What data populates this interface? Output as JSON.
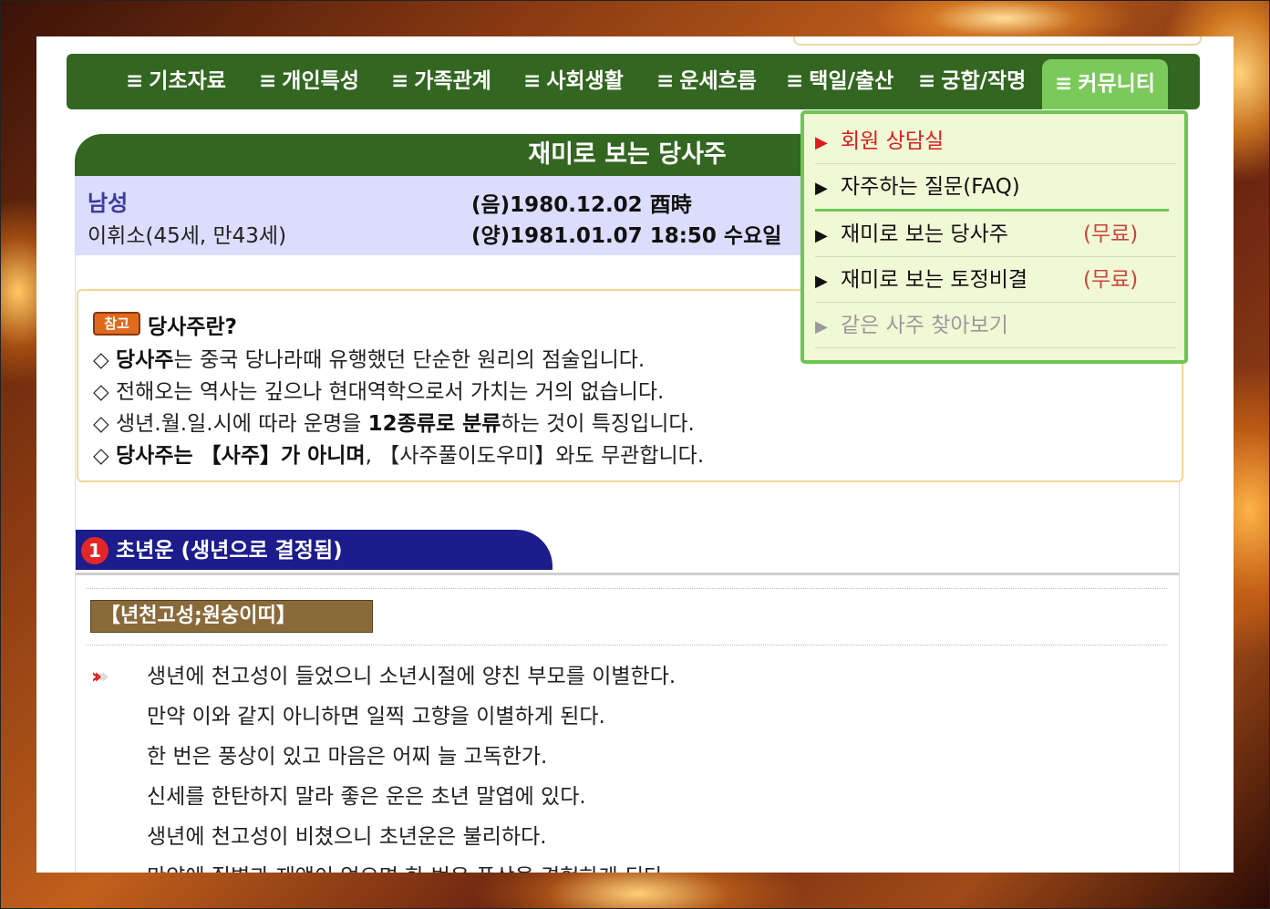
{
  "nav": {
    "glyph": "≡",
    "items": [
      {
        "label": "기초자료"
      },
      {
        "label": "개인특성"
      },
      {
        "label": "가족관계"
      },
      {
        "label": "사회생활"
      },
      {
        "label": "운세흐름"
      },
      {
        "label": "택일/출산"
      },
      {
        "label": "궁합/작명"
      },
      {
        "label": "커뮤니티"
      }
    ]
  },
  "dropdown": {
    "items": [
      {
        "label": "회원 상담실",
        "free": ""
      },
      {
        "label": "자주하는 질문(FAQ)",
        "free": ""
      },
      {
        "label": "재미로 보는 당사주",
        "free": "(무료)"
      },
      {
        "label": "재미로 보는 토정비결",
        "free": "(무료)"
      },
      {
        "label": "같은 사주 찾아보기",
        "free": ""
      }
    ],
    "marker": "▶"
  },
  "page": {
    "title": "재미로 보는 당사주",
    "gender": "남성",
    "name_age": "이휘소(45세, 만43세)",
    "lunar": "(음)1980.12.02 酉時",
    "solar": "(양)1981.01.07 18:50 수요일"
  },
  "note": {
    "badge": "참고",
    "heading": "당사주란?",
    "bullet": "◇",
    "line1_bold": "당사주",
    "line1_rest": "는 중국 당나라때 유행했던 단순한 원리의 점술입니다.",
    "line2": "전해오는 역사는 깊으나 현대역학으로서 가치는 거의 없습니다.",
    "line3_a": "생년.월.일.시에 따라 운명을 ",
    "line3_bold": "12종류로 분류",
    "line3_b": "하는 것이 특징입니다.",
    "line4_bold": "당사주는 【사주】가 아니며",
    "line4_rest": ", 【사주풀이도우미】와도 무관합니다."
  },
  "section1": {
    "number": "1",
    "title": "초년운 (생년으로 결정됨)",
    "star_title": "【년천고성;원숭이띠】",
    "lines": [
      "생년에 천고성이 들었으니 소년시절에 양친 부모를 이별한다.",
      "만약 이와 같지 아니하면 일찍 고향을 이별하게 된다.",
      "한 번은 풍상이 있고 마음은 어찌 늘 고독한가.",
      "신세를 한탄하지 말라 좋은 운은 초년 말엽에 있다.",
      "생년에 천고성이 비쳤으니 초년운은 불리하다.",
      "만약에 질병과 재액이 없으면 한 번은 풍상을 경험하게 된다."
    ]
  },
  "colors": {
    "nav_bg": "#336621",
    "nav_active": "#7cc95b",
    "section_blue": "#1c1c8c",
    "info_bg": "#dcdcfc",
    "accent_red": "#d8201f"
  }
}
